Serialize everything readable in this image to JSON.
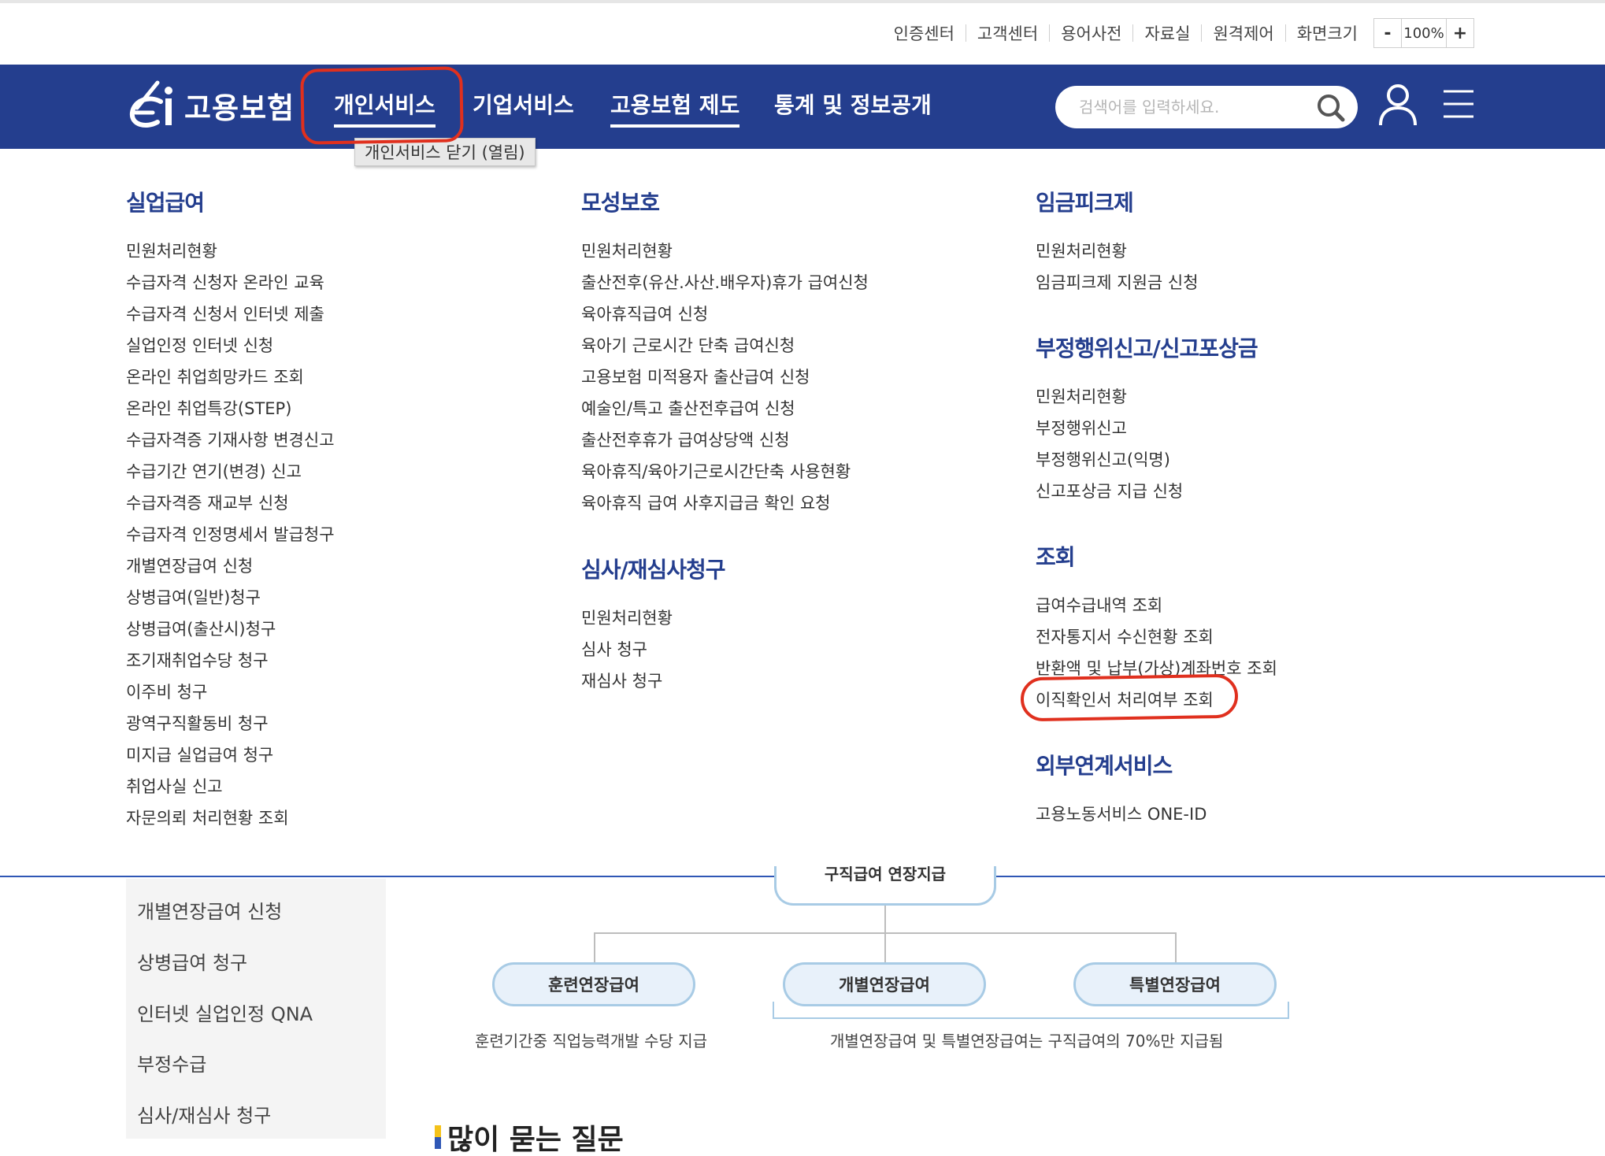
{
  "utility": {
    "links": [
      "인증센터",
      "고객센터",
      "용어사전",
      "자료실",
      "원격제어"
    ],
    "zoom_label": "화면크기",
    "zoom_minus": "-",
    "zoom_value": "100%",
    "zoom_plus": "+"
  },
  "header": {
    "logo_text": "고용보험",
    "nav": [
      "개인서비스",
      "기업서비스",
      "고용보험 제도",
      "통계 및 정보공개"
    ],
    "search_placeholder": "검색어를 입력하세요.",
    "colors": {
      "header_bg": "#243e8e",
      "accent": "#2f57b5"
    }
  },
  "tooltip": "개인서비스 닫기 (열림)",
  "mega_menu": {
    "col1": {
      "title": "실업급여",
      "links": [
        "민원처리현황",
        "수급자격 신청자 온라인 교육",
        "수급자격 신청서 인터넷 제출",
        "실업인정 인터넷 신청",
        "온라인 취업희망카드 조회",
        "온라인 취업특강(STEP)",
        "수급자격증 기재사항 변경신고",
        "수급기간 연기(변경) 신고",
        "수급자격증 재교부 신청",
        "수급자격 인정명세서 발급청구",
        "개별연장급여 신청",
        "상병급여(일반)청구",
        "상병급여(출산시)청구",
        "조기재취업수당 청구",
        "이주비 청구",
        "광역구직활동비 청구",
        "미지급 실업급여 청구",
        "취업사실 신고",
        "자문의뢰 처리현황 조회"
      ]
    },
    "col2a": {
      "title": "모성보호",
      "links": [
        "민원처리현황",
        "출산전후(유산.사산.배우자)휴가 급여신청",
        "육아휴직급여 신청",
        "육아기 근로시간 단축 급여신청",
        "고용보험 미적용자 출산급여 신청",
        "예술인/특고 출산전후급여 신청",
        "출산전후휴가 급여상당액 신청",
        "육아휴직/육아기근로시간단축 사용현황",
        "육아휴직 급여 사후지급금 확인 요청"
      ]
    },
    "col2b": {
      "title": "심사/재심사청구",
      "links": [
        "민원처리현황",
        "심사 청구",
        "재심사 청구"
      ]
    },
    "col3a": {
      "title": "임금피크제",
      "links": [
        "민원처리현황",
        "임금피크제 지원금 신청"
      ]
    },
    "col3b": {
      "title": "부정행위신고/신고포상금",
      "links": [
        "민원처리현황",
        "부정행위신고",
        "부정행위신고(익명)",
        "신고포상금 지급 신청"
      ]
    },
    "col3c": {
      "title": "조회",
      "links": [
        "급여수급내역 조회",
        "전자통지서 수신현황 조회",
        "반환액 및 납부(가상)계좌번호 조회",
        "이직확인서 처리여부 조회"
      ]
    },
    "col3d": {
      "title": "외부연계서비스",
      "links": [
        "고용노동서비스 ONE-ID"
      ]
    }
  },
  "background_page": {
    "sidebar": [
      "개별연장급여 신청",
      "상병급여 청구",
      "인터넷 실업인정 QNA",
      "부정수급",
      "심사/재심사 청구"
    ],
    "flow": {
      "top_box": "구직급여 연장지급",
      "pills": [
        "훈련연장급여",
        "개별연장급여",
        "특별연장급여"
      ],
      "caption_left": "훈련기간중 직업능력개발 수당 지급",
      "caption_right": "개별연장급여 및 특별연장급여는 구직급여의 70%만 지급됨"
    },
    "faq_title": "많이 묻는 질문"
  }
}
